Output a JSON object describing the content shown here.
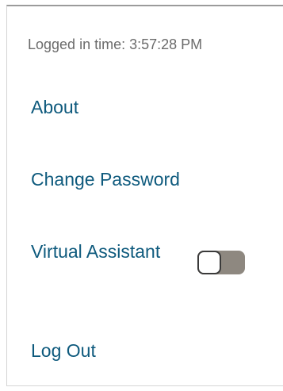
{
  "session": {
    "logged_in_time": "Logged in time: 3:57:28 PM"
  },
  "menu": {
    "about_label": "About",
    "change_password_label": "Change Password",
    "virtual_assistant_label": "Virtual Assistant",
    "virtual_assistant_enabled": false,
    "log_out_label": "Log Out"
  },
  "colors": {
    "link": "#0e5a7d",
    "muted_text": "#6b6b6b",
    "toggle_track": "#8e8880"
  }
}
